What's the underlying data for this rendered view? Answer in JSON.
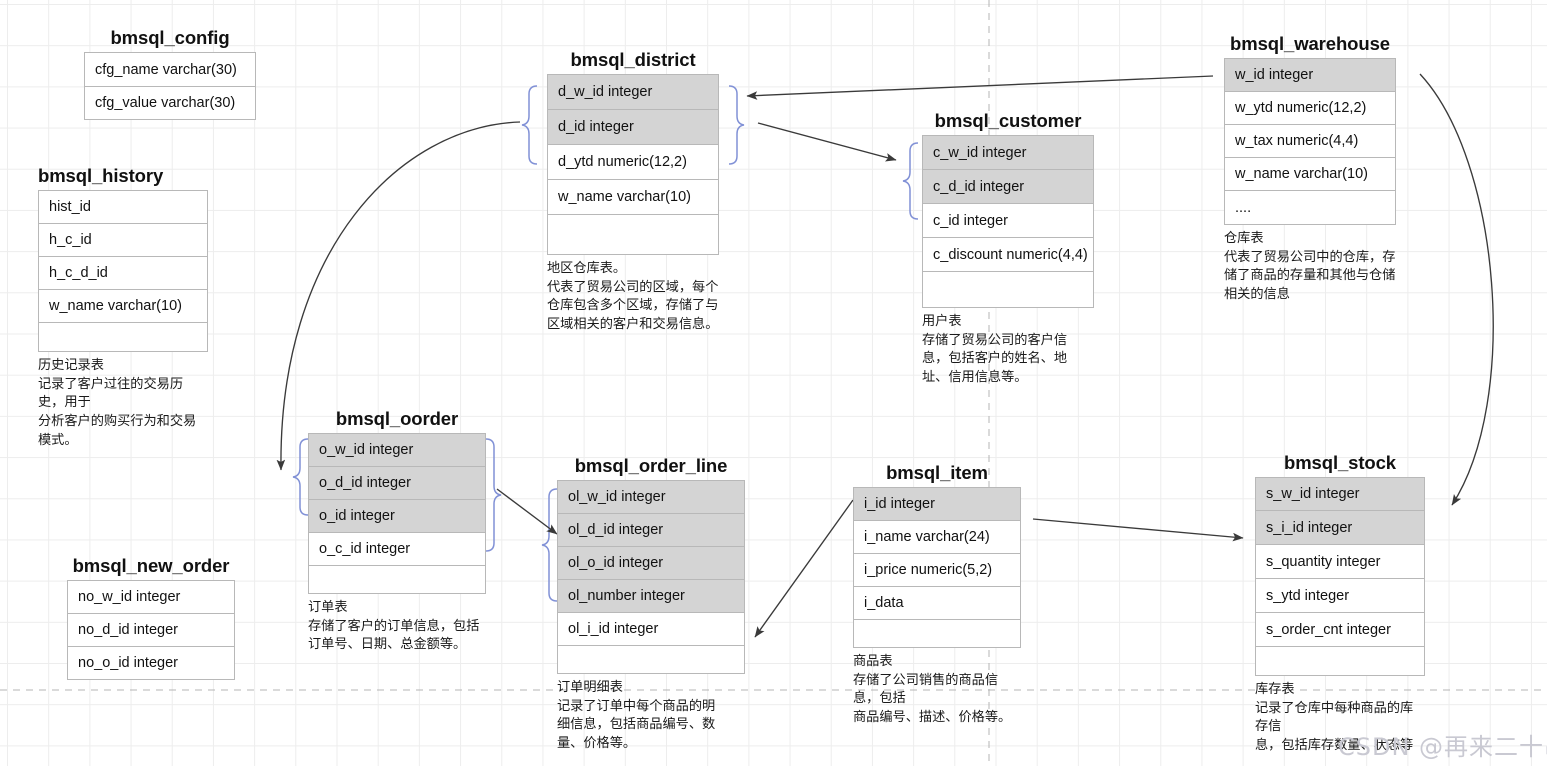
{
  "diagram": {
    "kind": "er-diagram",
    "watermark": "CSDN @再来二十串！",
    "colors": {
      "key_row_fill": "#d4d4d4",
      "row_border": "#b8b8b8",
      "brace": "#8191d6",
      "edge": "#3a3a3a",
      "grid": "#ededed",
      "page_break": "#b0b0b0"
    }
  },
  "tables": {
    "config": {
      "title": "bmsql_config",
      "rows": [
        {
          "text": "cfg_name  varchar(30)",
          "key": false
        },
        {
          "text": "cfg_value  varchar(30)",
          "key": false
        }
      ],
      "note": ""
    },
    "history": {
      "title": "bmsql_history",
      "rows": [
        {
          "text": "hist_id",
          "key": false
        },
        {
          "text": "h_c_id",
          "key": false
        },
        {
          "text": "h_c_d_id",
          "key": false
        },
        {
          "text": "w_name  varchar(10)",
          "key": false
        },
        {
          "text": "",
          "key": false
        }
      ],
      "note": "历史记录表\n记录了客户过往的交易历史，用于\n分析客户的购买行为和交易模式。"
    },
    "district": {
      "title": "bmsql_district",
      "rows": [
        {
          "text": "d_w_id integer",
          "key": true
        },
        {
          "text": "d_id integer",
          "key": true
        },
        {
          "text": "d_ytd numeric(12,2)",
          "key": false
        },
        {
          "text": "w_name  varchar(10)",
          "key": false
        },
        {
          "text": "",
          "key": false
        }
      ],
      "note": "地区仓库表。\n代表了贸易公司的区域，每个\n仓库包含多个区域，存储了与\n区域相关的客户和交易信息。"
    },
    "customer": {
      "title": "bmsql_customer",
      "rows": [
        {
          "text": "c_w_id integer",
          "key": true
        },
        {
          "text": "c_d_id integer",
          "key": true
        },
        {
          "text": "c_id integer",
          "key": false
        },
        {
          "text": "c_discount  numeric(4,4)",
          "key": false
        },
        {
          "text": "",
          "key": false
        }
      ],
      "note": "用户表\n存储了贸易公司的客户信\n息，包括客户的姓名、地\n址、信用信息等。"
    },
    "warehouse": {
      "title": "bmsql_warehouse",
      "rows": [
        {
          "text": "w_id integer",
          "key": true
        },
        {
          "text": "w_ytd numeric(12,2)",
          "key": false
        },
        {
          "text": "w_tax numeric(4,4)",
          "key": false
        },
        {
          "text": "w_name  varchar(10)",
          "key": false
        },
        {
          "text": "....",
          "key": false
        }
      ],
      "note": "仓库表\n代表了贸易公司中的仓库，存\n储了商品的存量和其他与仓储\n相关的信息"
    },
    "oorder": {
      "title": "bmsql_oorder",
      "rows": [
        {
          "text": "o_w_id integer",
          "key": true
        },
        {
          "text": "o_d_id integer",
          "key": true
        },
        {
          "text": "o_id integer",
          "key": true
        },
        {
          "text": "o_c_id integer",
          "key": false
        },
        {
          "text": "",
          "key": false
        }
      ],
      "note": "订单表\n存储了客户的订单信息，包括\n订单号、日期、总金额等。"
    },
    "order_line": {
      "title": "bmsql_order_line",
      "rows": [
        {
          "text": "ol_w_id integer",
          "key": true
        },
        {
          "text": "ol_d_id integer",
          "key": true
        },
        {
          "text": "ol_o_id integer",
          "key": true
        },
        {
          "text": "ol_number integer",
          "key": true
        },
        {
          "text": "ol_i_id integer",
          "key": false
        },
        {
          "text": "",
          "key": false
        }
      ],
      "note": "订单明细表\n记录了订单中每个商品的明\n细信息，包括商品编号、数\n量、价格等。"
    },
    "item": {
      "title": "bmsql_item",
      "rows": [
        {
          "text": "i_id integer",
          "key": true
        },
        {
          "text": "i_name varchar(24)",
          "key": false
        },
        {
          "text": "i_price numeric(5,2)",
          "key": false
        },
        {
          "text": "i_data",
          "key": false
        },
        {
          "text": "",
          "key": false
        }
      ],
      "note": "商品表\n存储了公司销售的商品信息，包括\n商品编号、描述、价格等。"
    },
    "stock": {
      "title": "bmsql_stock",
      "rows": [
        {
          "text": "s_w_id integer",
          "key": true
        },
        {
          "text": "s_i_id integer",
          "key": true
        },
        {
          "text": "s_quantity integer",
          "key": false
        },
        {
          "text": "s_ytd integer",
          "key": false
        },
        {
          "text": "s_order_cnt integer",
          "key": false
        },
        {
          "text": "",
          "key": false
        }
      ],
      "note": "库存表\n记录了仓库中每种商品的库存信\n息，包括库存数量、状态等"
    },
    "new_order": {
      "title": "bmsql_new_order",
      "rows": [
        {
          "text": "no_w_id integer",
          "key": false
        },
        {
          "text": "no_d_id integer",
          "key": false
        },
        {
          "text": "no_o_id integer",
          "key": false
        }
      ],
      "note": ""
    }
  },
  "relationships": [
    {
      "from": "warehouse.w_id",
      "to": "district.keys",
      "style": "straight-arrow"
    },
    {
      "from": "district.keys",
      "to": "customer.keys",
      "style": "straight-arrow"
    },
    {
      "from": "district.keys",
      "to": "oorder.keys",
      "style": "curved-arrow"
    },
    {
      "from": "oorder.keys",
      "to": "order_line.keys",
      "style": "straight-arrow"
    },
    {
      "from": "item.i_id",
      "to": "order_line.ol_i_id",
      "style": "straight-arrow"
    },
    {
      "from": "item.i_id",
      "to": "stock.s_i_id",
      "style": "straight-arrow"
    },
    {
      "from": "warehouse.w_id",
      "to": "stock.s_w_id",
      "style": "curved-arrow"
    }
  ]
}
